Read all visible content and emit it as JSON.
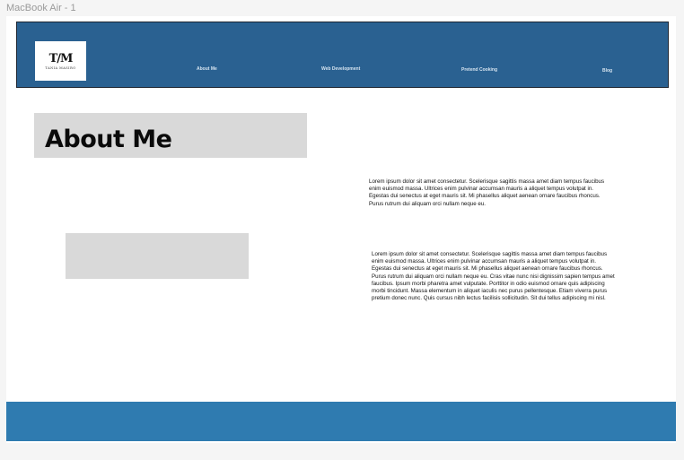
{
  "frame": {
    "label": "MacBook Air - 1"
  },
  "header": {
    "logo": {
      "mark": "T/M",
      "subtitle": "TANIA MASIRO"
    },
    "nav": [
      {
        "label": "About Me"
      },
      {
        "label": "Web Development"
      },
      {
        "label": "Pretend Cooking"
      },
      {
        "label": "Blog"
      }
    ]
  },
  "main": {
    "title": "About Me",
    "paragraphs": [
      "Lorem ipsum dolor sit amet consectetur. Scelerisque sagittis massa amet diam tempus faucibus enim euismod massa. Ultrices enim pulvinar accumsan mauris a aliquet tempus volutpat in. Egestas dui senectus at eget mauris sit. Mi phasellus aliquet aenean ornare faucibus rhoncus. Purus rutrum dui aliquam orci nullam neque eu.",
      "Lorem ipsum dolor sit amet consectetur. Scelerisque sagittis massa amet diam tempus faucibus enim euismod massa. Ultrices enim pulvinar accumsan mauris a aliquet tempus volutpat in. Egestas dui senectus at eget mauris sit. Mi phasellus aliquet aenean ornare faucibus rhoncus. Purus rutrum dui aliquam orci nullam neque eu. Cras vitae nunc nisi dignissim sapien tempus amet faucibus. Ipsum morbi pharetra amet vulputate. Porttitor in odio euismod ornare quis adipiscing morbi tincidunt. Massa elementum in aliquet iaculis nec purus pellentesque. Etiam viverra purus pretium donec nunc. Quis cursus nibh lectus facilisis sollicitudin. Sit dui tellus adipiscing mi nisl."
    ]
  },
  "colors": {
    "header_bg": "#2a6191",
    "footer_bg": "#2f7bb0",
    "placeholder": "#d9d9d9",
    "nav_text": "#d6e4f0"
  }
}
